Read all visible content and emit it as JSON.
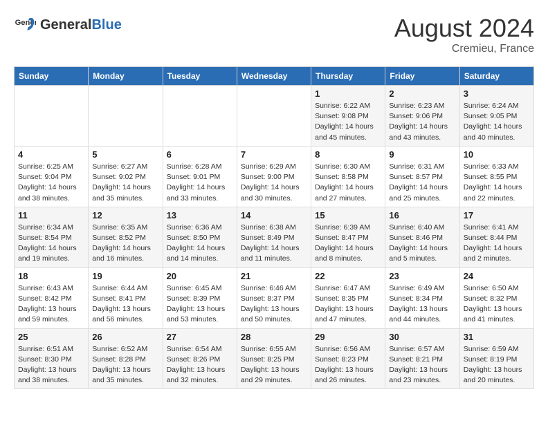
{
  "header": {
    "logo_general": "General",
    "logo_blue": "Blue",
    "month_year": "August 2024",
    "location": "Cremieu, France"
  },
  "days_of_week": [
    "Sunday",
    "Monday",
    "Tuesday",
    "Wednesday",
    "Thursday",
    "Friday",
    "Saturday"
  ],
  "weeks": [
    [
      {
        "day": "",
        "info": ""
      },
      {
        "day": "",
        "info": ""
      },
      {
        "day": "",
        "info": ""
      },
      {
        "day": "",
        "info": ""
      },
      {
        "day": "1",
        "info": "Sunrise: 6:22 AM\nSunset: 9:08 PM\nDaylight: 14 hours and 45 minutes."
      },
      {
        "day": "2",
        "info": "Sunrise: 6:23 AM\nSunset: 9:06 PM\nDaylight: 14 hours and 43 minutes."
      },
      {
        "day": "3",
        "info": "Sunrise: 6:24 AM\nSunset: 9:05 PM\nDaylight: 14 hours and 40 minutes."
      }
    ],
    [
      {
        "day": "4",
        "info": "Sunrise: 6:25 AM\nSunset: 9:04 PM\nDaylight: 14 hours and 38 minutes."
      },
      {
        "day": "5",
        "info": "Sunrise: 6:27 AM\nSunset: 9:02 PM\nDaylight: 14 hours and 35 minutes."
      },
      {
        "day": "6",
        "info": "Sunrise: 6:28 AM\nSunset: 9:01 PM\nDaylight: 14 hours and 33 minutes."
      },
      {
        "day": "7",
        "info": "Sunrise: 6:29 AM\nSunset: 9:00 PM\nDaylight: 14 hours and 30 minutes."
      },
      {
        "day": "8",
        "info": "Sunrise: 6:30 AM\nSunset: 8:58 PM\nDaylight: 14 hours and 27 minutes."
      },
      {
        "day": "9",
        "info": "Sunrise: 6:31 AM\nSunset: 8:57 PM\nDaylight: 14 hours and 25 minutes."
      },
      {
        "day": "10",
        "info": "Sunrise: 6:33 AM\nSunset: 8:55 PM\nDaylight: 14 hours and 22 minutes."
      }
    ],
    [
      {
        "day": "11",
        "info": "Sunrise: 6:34 AM\nSunset: 8:54 PM\nDaylight: 14 hours and 19 minutes."
      },
      {
        "day": "12",
        "info": "Sunrise: 6:35 AM\nSunset: 8:52 PM\nDaylight: 14 hours and 16 minutes."
      },
      {
        "day": "13",
        "info": "Sunrise: 6:36 AM\nSunset: 8:50 PM\nDaylight: 14 hours and 14 minutes."
      },
      {
        "day": "14",
        "info": "Sunrise: 6:38 AM\nSunset: 8:49 PM\nDaylight: 14 hours and 11 minutes."
      },
      {
        "day": "15",
        "info": "Sunrise: 6:39 AM\nSunset: 8:47 PM\nDaylight: 14 hours and 8 minutes."
      },
      {
        "day": "16",
        "info": "Sunrise: 6:40 AM\nSunset: 8:46 PM\nDaylight: 14 hours and 5 minutes."
      },
      {
        "day": "17",
        "info": "Sunrise: 6:41 AM\nSunset: 8:44 PM\nDaylight: 14 hours and 2 minutes."
      }
    ],
    [
      {
        "day": "18",
        "info": "Sunrise: 6:43 AM\nSunset: 8:42 PM\nDaylight: 13 hours and 59 minutes."
      },
      {
        "day": "19",
        "info": "Sunrise: 6:44 AM\nSunset: 8:41 PM\nDaylight: 13 hours and 56 minutes."
      },
      {
        "day": "20",
        "info": "Sunrise: 6:45 AM\nSunset: 8:39 PM\nDaylight: 13 hours and 53 minutes."
      },
      {
        "day": "21",
        "info": "Sunrise: 6:46 AM\nSunset: 8:37 PM\nDaylight: 13 hours and 50 minutes."
      },
      {
        "day": "22",
        "info": "Sunrise: 6:47 AM\nSunset: 8:35 PM\nDaylight: 13 hours and 47 minutes."
      },
      {
        "day": "23",
        "info": "Sunrise: 6:49 AM\nSunset: 8:34 PM\nDaylight: 13 hours and 44 minutes."
      },
      {
        "day": "24",
        "info": "Sunrise: 6:50 AM\nSunset: 8:32 PM\nDaylight: 13 hours and 41 minutes."
      }
    ],
    [
      {
        "day": "25",
        "info": "Sunrise: 6:51 AM\nSunset: 8:30 PM\nDaylight: 13 hours and 38 minutes."
      },
      {
        "day": "26",
        "info": "Sunrise: 6:52 AM\nSunset: 8:28 PM\nDaylight: 13 hours and 35 minutes."
      },
      {
        "day": "27",
        "info": "Sunrise: 6:54 AM\nSunset: 8:26 PM\nDaylight: 13 hours and 32 minutes."
      },
      {
        "day": "28",
        "info": "Sunrise: 6:55 AM\nSunset: 8:25 PM\nDaylight: 13 hours and 29 minutes."
      },
      {
        "day": "29",
        "info": "Sunrise: 6:56 AM\nSunset: 8:23 PM\nDaylight: 13 hours and 26 minutes."
      },
      {
        "day": "30",
        "info": "Sunrise: 6:57 AM\nSunset: 8:21 PM\nDaylight: 13 hours and 23 minutes."
      },
      {
        "day": "31",
        "info": "Sunrise: 6:59 AM\nSunset: 8:19 PM\nDaylight: 13 hours and 20 minutes."
      }
    ]
  ]
}
